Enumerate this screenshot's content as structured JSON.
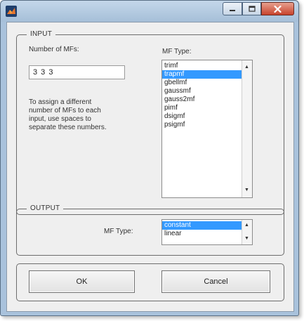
{
  "input_group": {
    "title": "INPUT",
    "number_label": "Number of MFs:",
    "number_value": "3 3 3",
    "mf_type_label": "MF Type:",
    "note_lines": [
      "To assign a different",
      "number of MFs to each",
      "input, use spaces to",
      "separate these numbers."
    ],
    "mf_types": [
      "trimf",
      "trapmf",
      "gbellmf",
      "gaussmf",
      "gauss2mf",
      "pimf",
      "dsigmf",
      "psigmf"
    ],
    "selected_mf_type": "trapmf"
  },
  "output_group": {
    "title": "OUTPUT",
    "mf_type_label": "MF Type:",
    "mf_types": [
      "constant",
      "linear"
    ],
    "selected_mf_type": "constant"
  },
  "buttons": {
    "ok_label": "OK",
    "cancel_label": "Cancel"
  },
  "colors": {
    "selection": "#3399ff",
    "window_frame": "#a9c2dc",
    "close_button": "#c8432c"
  },
  "icons": {
    "app_icon": "matlab-icon",
    "minimize": "minimize-icon",
    "maximize": "maximize-icon",
    "close": "close-icon"
  }
}
